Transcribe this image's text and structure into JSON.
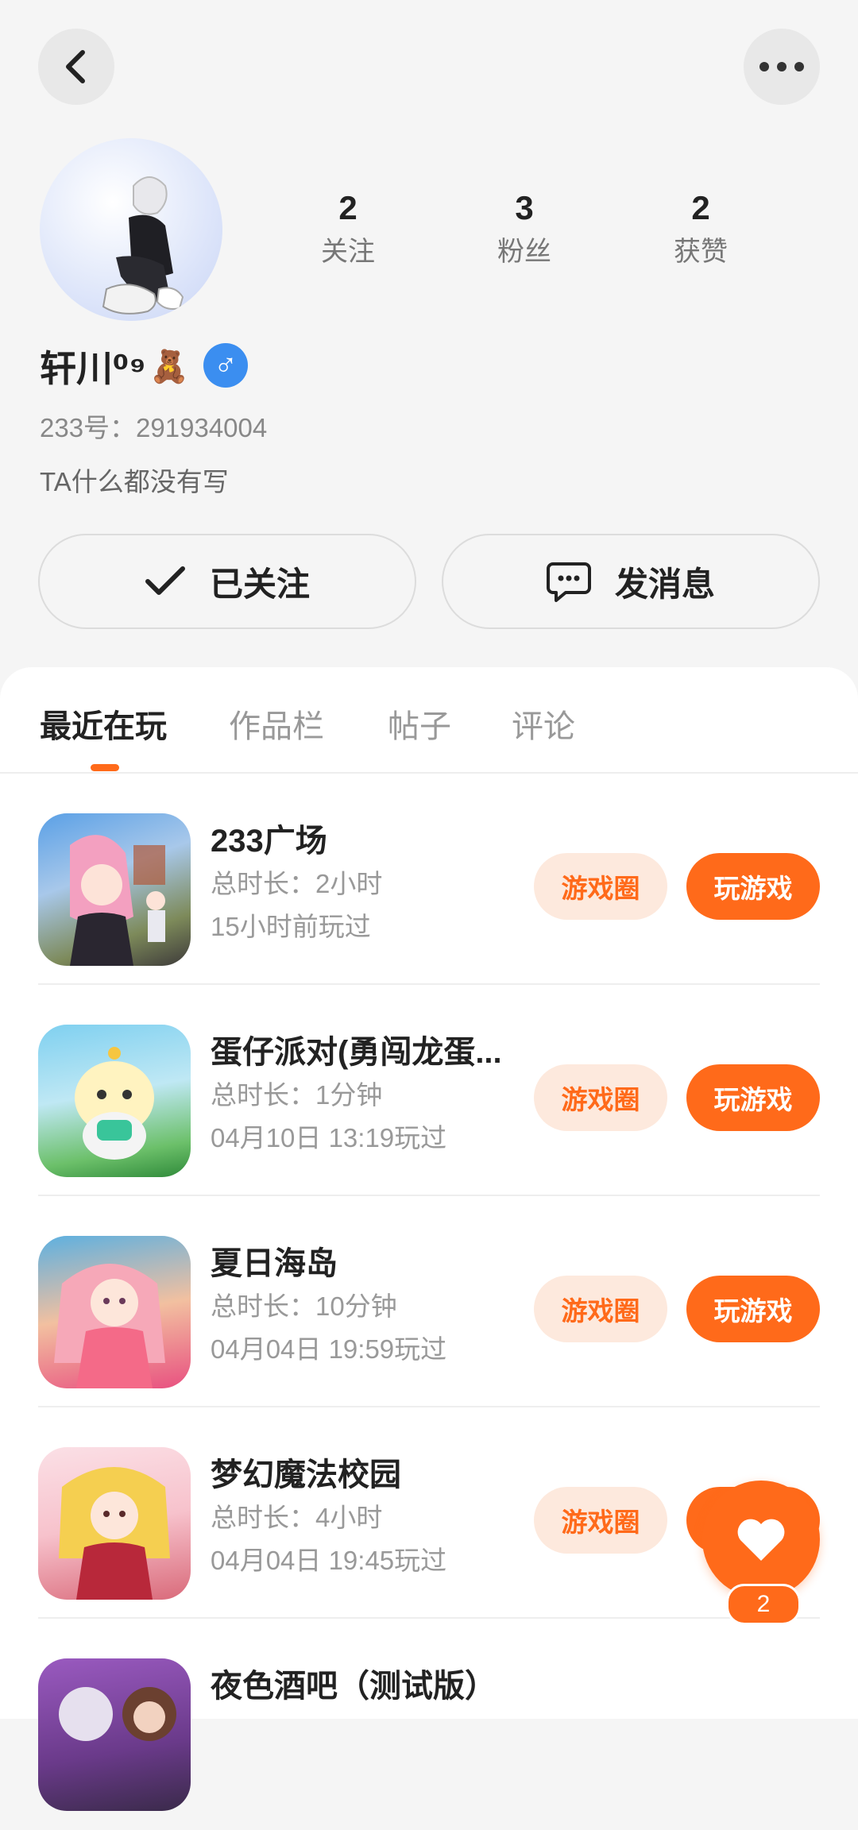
{
  "header": {
    "back_icon": "chevron-left-icon",
    "more_icon": "more-dots-icon"
  },
  "profile": {
    "stats": [
      {
        "value": "2",
        "label": "关注"
      },
      {
        "value": "3",
        "label": "粉丝"
      },
      {
        "value": "2",
        "label": "获赞"
      }
    ],
    "name": "轩川⁰⁹",
    "name_emoji": "🧸",
    "gender_symbol": "♂",
    "uid": "233号：291934004",
    "bio": "TA什么都没有写"
  },
  "actions": {
    "follow_label": "已关注",
    "message_label": "发消息"
  },
  "tabs": [
    {
      "label": "最近在玩",
      "active": true
    },
    {
      "label": "作品栏",
      "active": false
    },
    {
      "label": "帖子",
      "active": false
    },
    {
      "label": "评论",
      "active": false
    }
  ],
  "games": [
    {
      "name": "233广场",
      "duration": "总时长：2小时",
      "last_played": "15小时前玩过",
      "circle_label": "游戏圈",
      "play_label": "玩游戏"
    },
    {
      "name": "蛋仔派对(勇闯龙蛋...",
      "duration": "总时长：1分钟",
      "last_played": "04月10日 13:19玩过",
      "circle_label": "游戏圈",
      "play_label": "玩游戏"
    },
    {
      "name": "夏日海岛",
      "duration": "总时长：10分钟",
      "last_played": "04月04日 19:59玩过",
      "circle_label": "游戏圈",
      "play_label": "玩游戏"
    },
    {
      "name": "梦幻魔法校园",
      "duration": "总时长：4小时",
      "last_played": "04月04日 19:45玩过",
      "circle_label": "游戏圈",
      "play_label": "玩游戏"
    },
    {
      "name": "夜色酒吧（测试版）",
      "duration": "",
      "last_played": "",
      "circle_label": "",
      "play_label": ""
    }
  ],
  "like": {
    "count": "2"
  },
  "colors": {
    "accent": "#ff6a1a",
    "tag_bg": "#fde9dd",
    "gender": "#3b8ef0"
  }
}
